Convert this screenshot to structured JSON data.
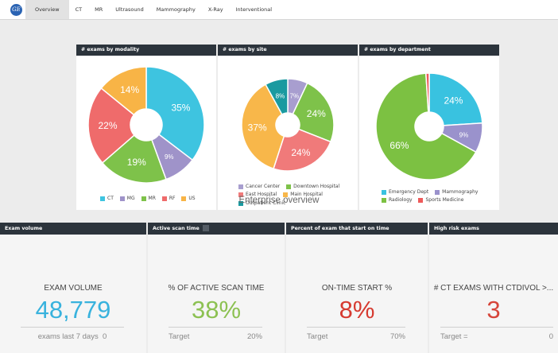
{
  "nav": {
    "logo_text": "GE",
    "tabs": [
      "Overview",
      "CT",
      "MR",
      "Ultrasound",
      "Mammography",
      "X-Ray",
      "Interventional"
    ],
    "active_tab": "Overview"
  },
  "chart_data": [
    {
      "type": "pie",
      "title": "# exams by modality",
      "categories": [
        "CT",
        "MG",
        "MR",
        "RF",
        "US"
      ],
      "values": [
        35,
        9,
        19,
        22,
        14
      ],
      "labels": [
        "35%",
        "9%",
        "19%",
        "22%",
        "14%"
      ],
      "colors": [
        "#3ec4e0",
        "#9f93c9",
        "#7ec24a",
        "#ef6b6b",
        "#f8b446"
      ],
      "legend": "bottom"
    },
    {
      "type": "pie",
      "title": "# exams by site",
      "categories": [
        "Cancer Center",
        "Downtown Hospital",
        "East Hospital",
        "Main Hospital",
        "Outpatient Clinic"
      ],
      "values": [
        7,
        24,
        24,
        37,
        8
      ],
      "labels": [
        "7%",
        "24%",
        "24%",
        "37%",
        "8%"
      ],
      "colors": [
        "#a89ecf",
        "#7ec24a",
        "#f07a7a",
        "#f8b74a",
        "#1a9aa0"
      ],
      "legend": "bottom"
    },
    {
      "type": "pie",
      "title": "# exams by department",
      "categories": [
        "Emergency Dept",
        "Mammography",
        "Radiology",
        "Sports Medicine"
      ],
      "values": [
        24,
        9,
        66,
        1
      ],
      "labels": [
        "24%",
        "9%",
        "66%",
        ""
      ],
      "colors": [
        "#39c2e0",
        "#9a92cc",
        "#7cc142",
        "#ee5a5a"
      ],
      "legend": "bottom"
    }
  ],
  "enterprise_title": "Enterprise overview",
  "cards": [
    {
      "header": "Exam volume",
      "label": "EXAM VOLUME",
      "value": "48,779",
      "value_color": "#38b2dd",
      "foot_left": "exams last 7 days",
      "foot_right": "0",
      "has_square": false
    },
    {
      "header": "Active scan time",
      "label": "% OF ACTIVE SCAN TIME",
      "value": "38%",
      "value_color": "#8cc152",
      "foot_left": "Target",
      "foot_right": "20%",
      "has_square": true
    },
    {
      "header": "Percent of exam that start on time",
      "label": "ON-TIME START %",
      "value": "8%",
      "value_color": "#d63a30",
      "foot_left": "Target",
      "foot_right": "70%",
      "has_square": false
    },
    {
      "header": "High risk exams",
      "label": "# CT EXAMS WITH CTDIVOL >...",
      "value": "3",
      "value_color": "#d6453a",
      "foot_left": "Target =",
      "foot_right": "0",
      "has_square": false
    }
  ]
}
